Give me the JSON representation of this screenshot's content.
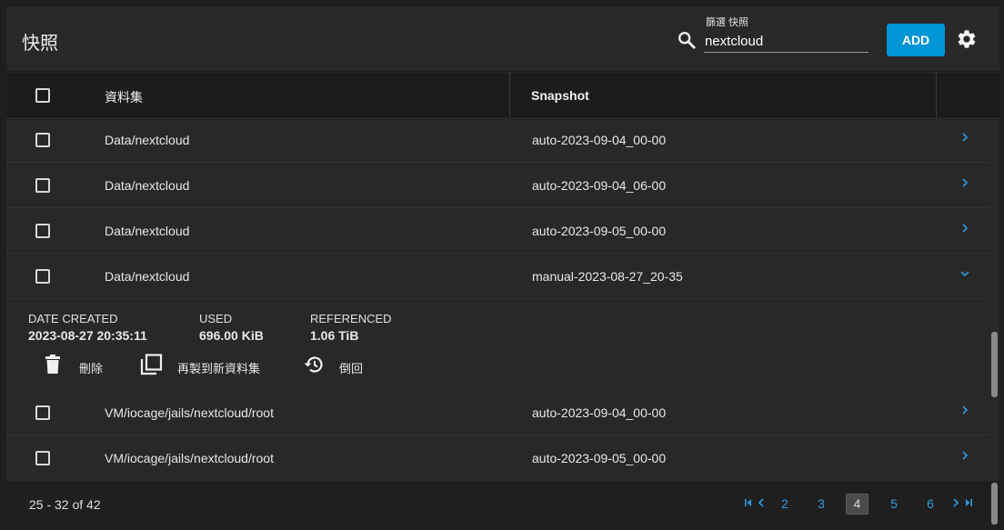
{
  "header": {
    "title": "快照",
    "filter_label": "篩選 快照",
    "filter_value": "nextcloud",
    "add_label": "ADD"
  },
  "table": {
    "columns": [
      "資料集",
      "Snapshot"
    ],
    "rows": [
      {
        "dataset": "Data/nextcloud",
        "snapshot": "auto-2023-09-04_00-00",
        "expanded": false
      },
      {
        "dataset": "Data/nextcloud",
        "snapshot": "auto-2023-09-04_06-00",
        "expanded": false
      },
      {
        "dataset": "Data/nextcloud",
        "snapshot": "auto-2023-09-05_00-00",
        "expanded": false
      },
      {
        "dataset": "Data/nextcloud",
        "snapshot": "manual-2023-08-27_20-35",
        "expanded": true
      },
      {
        "dataset": "VM/iocage/jails/nextcloud/root",
        "snapshot": "auto-2023-09-04_00-00",
        "expanded": false
      },
      {
        "dataset": "VM/iocage/jails/nextcloud/root",
        "snapshot": "auto-2023-09-05_00-00",
        "expanded": false
      }
    ]
  },
  "detail": {
    "date_created_label": "DATE CREATED",
    "date_created": "2023-08-27 20:35:11",
    "used_label": "USED",
    "used": "696.00 KiB",
    "referenced_label": "REFERENCED",
    "referenced": "1.06 TiB",
    "actions": {
      "delete": "刪除",
      "clone": "再製到新資料集",
      "rollback": "倒回"
    }
  },
  "pagination": {
    "range": "25 - 32 of 42",
    "pages": [
      "2",
      "3",
      "4",
      "5",
      "6"
    ],
    "current": "4"
  },
  "colors": {
    "accent": "#0095d5",
    "link": "#2f9bdc",
    "background": "#282828"
  }
}
